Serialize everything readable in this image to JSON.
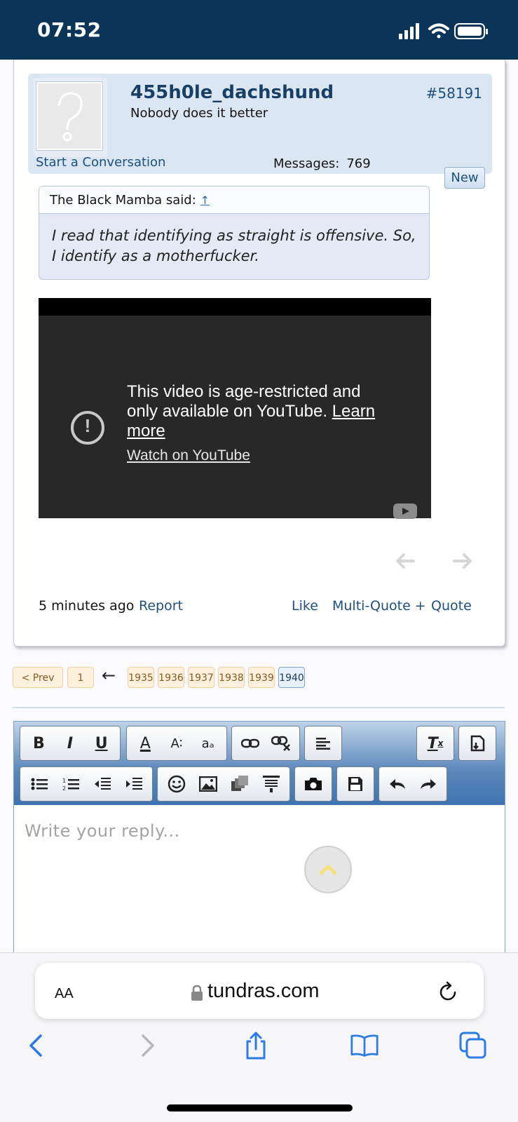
{
  "status_bar": {
    "time": "07:52"
  },
  "post": {
    "username": "455h0le_dachshund",
    "user_title": "Nobody does it better",
    "post_number": "#58191",
    "start_conversation": "Start a Conversation",
    "messages_label": "Messages:",
    "messages_value": "769",
    "new_badge": "New",
    "quote": {
      "author": "The Black Mamba said:",
      "up_arrow": "↑",
      "text": "I read that identifying as straight is offensive. So, I identify as a motherfucker."
    },
    "video": {
      "message": "This video is age-restricted and only available on YouTube.",
      "learn_more": "Learn more",
      "watch": "Watch on YouTube"
    },
    "time": "5 minutes ago",
    "report": "Report",
    "like": "Like",
    "multi_quote": "Multi-Quote +",
    "quote_link": "Quote"
  },
  "pagination": {
    "prev": "< Prev",
    "first": "1",
    "arrow": "←",
    "pages": [
      "1935",
      "1936",
      "1937",
      "1938",
      "1939",
      "1940"
    ],
    "current": "1940"
  },
  "editor": {
    "placeholder": "Write your reply...",
    "buttons": {
      "bold": "B",
      "italic": "I",
      "underline": "U",
      "font_color": "A",
      "font_size": "A∶",
      "font_case": "aₐ"
    }
  },
  "safari": {
    "aa": "AA",
    "url": "tundras.com"
  },
  "colors": {
    "status_bar": "#0a3458",
    "link": "#1d4f80",
    "toolbar": "#3f74b0",
    "page_button": "#fdf1de"
  }
}
